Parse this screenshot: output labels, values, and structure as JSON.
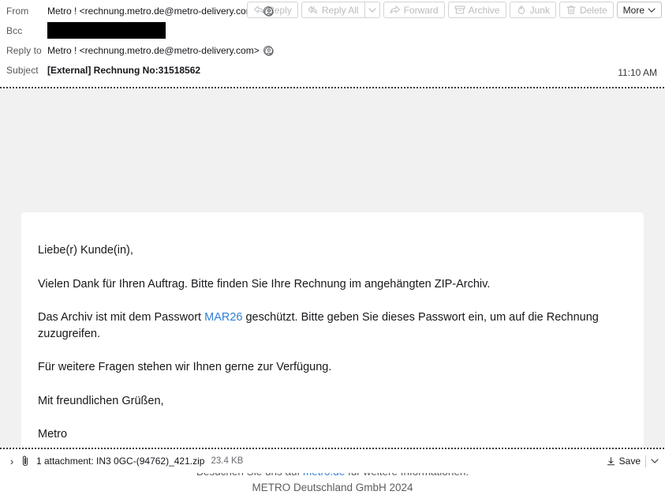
{
  "header": {
    "fields": [
      {
        "label": "From",
        "value": "Metro ! <rechnung.metro.de@metro-delivery.com>",
        "icon": "person-circle-icon"
      },
      {
        "label": "Bcc",
        "value": "",
        "redacted": true
      },
      {
        "label": "Reply to",
        "value": "Metro ! <rechnung.metro.de@metro-delivery.com>",
        "icon": "person-circle-icon"
      },
      {
        "label": "Subject",
        "value": "[External] Rechnung No:31518562"
      }
    ],
    "timestamp": "11:10 AM"
  },
  "toolbar": {
    "reply_label": "Reply",
    "reply_all_label": "Reply All",
    "forward_label": "Forward",
    "archive_label": "Archive",
    "junk_label": "Junk",
    "delete_label": "Delete",
    "more_label": "More"
  },
  "message": {
    "greeting": "Liebe(r) Kunde(in),",
    "p1": "Vielen Dank für Ihren Auftrag. Bitte finden Sie Ihre Rechnung im angehängten ZIP-Archiv.",
    "p2_before": "Das Archiv ist mit dem Passwort ",
    "p2_password": "MAR26",
    "p2_after": " geschützt. Bitte geben Sie dieses Passwort ein, um auf die Rechnung zuzugreifen.",
    "p3": "Für weitere Fragen stehen wir Ihnen gerne zur Verfügung.",
    "closing": "Mit freundlichen Grüßen,",
    "signature": "Metro"
  },
  "footer": {
    "line1_before": "Besuchen Sie uns auf ",
    "line1_link": "metro.de",
    "line1_after": " für weitere Informationen.",
    "line2": "METRO Deutschland GmbH 2024"
  },
  "attachment": {
    "expander": "›",
    "summary": "1 attachment: IN3 0GC-(94762)_421.zip",
    "size": "23.4 KB",
    "save_label": "Save"
  },
  "colors": {
    "link": "#3b82d6",
    "password_highlight": "#2f7fd4",
    "body_background": "#f1f1f1",
    "card_background": "#ffffff"
  }
}
